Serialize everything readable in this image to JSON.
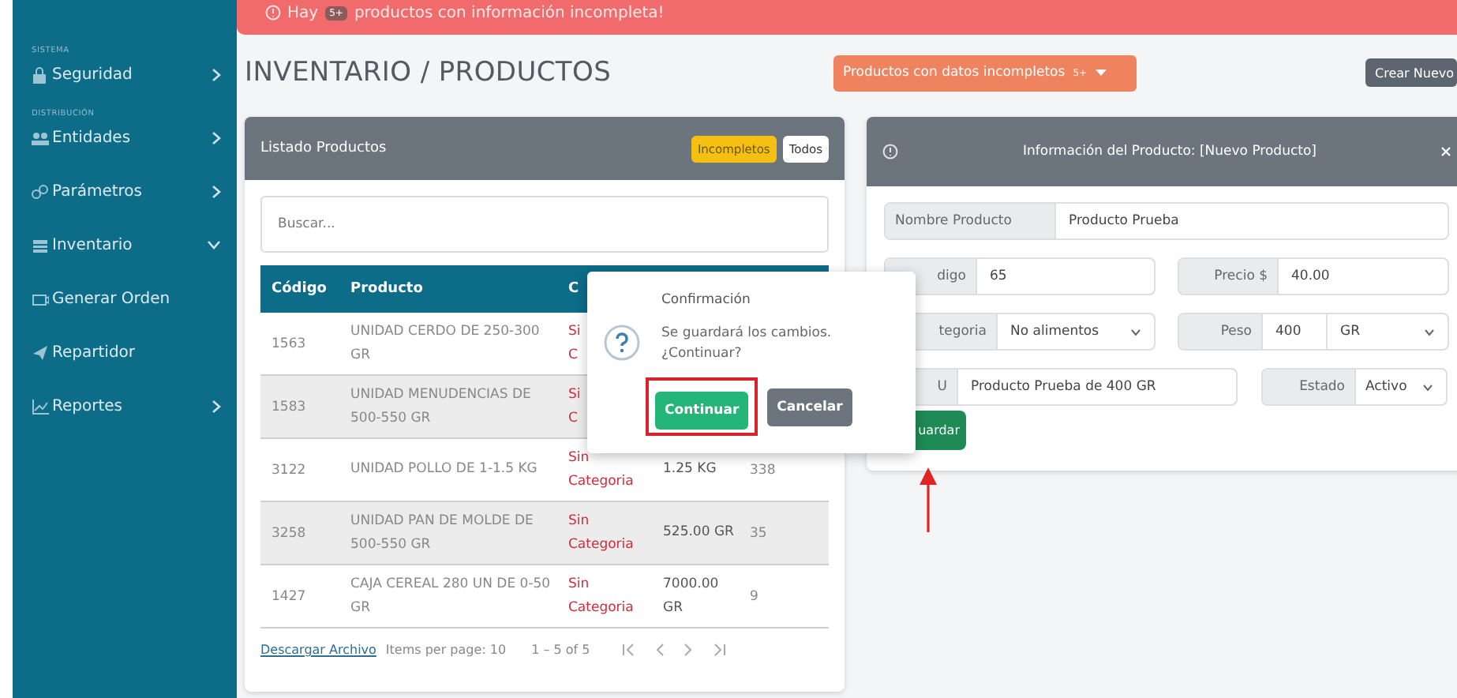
{
  "alert": {
    "lead": "Hay",
    "badge": "5+",
    "message": "productos con información incompleta!"
  },
  "sidebar": {
    "sections": [
      {
        "label": "SISTEMA",
        "items": [
          {
            "label": "Seguridad",
            "kind": "group",
            "expanded": false
          }
        ]
      },
      {
        "label": "DISTRIBUCIÓN",
        "items": [
          {
            "label": "Entidades",
            "kind": "group",
            "expanded": false
          },
          {
            "label": "Parámetros",
            "kind": "group",
            "expanded": false
          },
          {
            "label": "Inventario",
            "kind": "group",
            "expanded": true
          },
          {
            "label": "Generar Orden",
            "kind": "link"
          },
          {
            "label": "Repartidor",
            "kind": "link"
          },
          {
            "label": "Reportes",
            "kind": "group",
            "expanded": false
          }
        ]
      }
    ]
  },
  "page_title": "INVENTARIO / PRODUCTOS",
  "incomplete_dropdown": {
    "label": "Productos con datos incompletos",
    "badge": "5+"
  },
  "create_button": "Crear Nuevo",
  "list_card": {
    "title": "Listado Productos",
    "filters": [
      {
        "label": "Incompletos",
        "selected": true
      },
      {
        "label": "Todos",
        "selected": false
      }
    ],
    "search": {
      "placeholder": "Buscar..."
    },
    "table": {
      "columns": [
        "Código",
        "Producto",
        "C"
      ],
      "rows": [
        {
          "code": "1563",
          "product": "UNIDAD CERDO DE 250-300 GR",
          "category": "Si\nC"
        },
        {
          "code": "1583",
          "product": "UNIDAD MENUDENCIAS DE 500-550 GR",
          "category": "Si\nC"
        },
        {
          "code": "3122",
          "product": "UNIDAD POLLO DE 1-1.5 KG",
          "category": "Sin Categoria",
          "column_4": "1.25 KG",
          "column_5": "338"
        },
        {
          "code": "3258",
          "product": "UNIDAD PAN DE MOLDE DE 500-550 GR",
          "category": "Sin Categoria",
          "column_4": "525.00 GR",
          "column_5": "35"
        },
        {
          "code": "1427",
          "product": "CAJA CEREAL 280 UN DE 0-50 GR",
          "category": "Sin Categoria",
          "column_4": "7000.00 GR",
          "column_5": "9"
        }
      ]
    },
    "footer": {
      "download_link": "Descargar Archivo",
      "items_per_page": "Items per page: 10",
      "range": "1 – 5 of 5"
    }
  },
  "product_form": {
    "title": "Información del Producto: [Nuevo Producto]",
    "rows": [
      [
        {
          "kind": "text",
          "label": "Nombre Producto",
          "value": "Producto Prueba"
        }
      ],
      [
        {
          "kind": "text",
          "label": "digo",
          "value": "65"
        },
        {
          "kind": "text",
          "label": "Precio $",
          "value": "40.00"
        }
      ],
      [
        {
          "kind": "select",
          "label": "tegoria",
          "value": "No alimentos"
        },
        {
          "kind": "unit",
          "label": "Peso",
          "value": "400",
          "unit": "GR"
        }
      ],
      [
        {
          "kind": "text",
          "label": "U",
          "value": "Producto Prueba de 400 GR"
        },
        {
          "kind": "select",
          "label": "Estado",
          "value": "Activo"
        }
      ]
    ],
    "save_button": "uardar"
  },
  "confirm_popover": {
    "title": "Confirmación",
    "message": "Se guardará los cambios.\n¿Continuar?",
    "buttons": [
      {
        "label": "Continuar",
        "kind": "primary",
        "highlighted": true
      },
      {
        "label": "Cancelar",
        "kind": "secondary",
        "highlighted": false
      }
    ]
  }
}
